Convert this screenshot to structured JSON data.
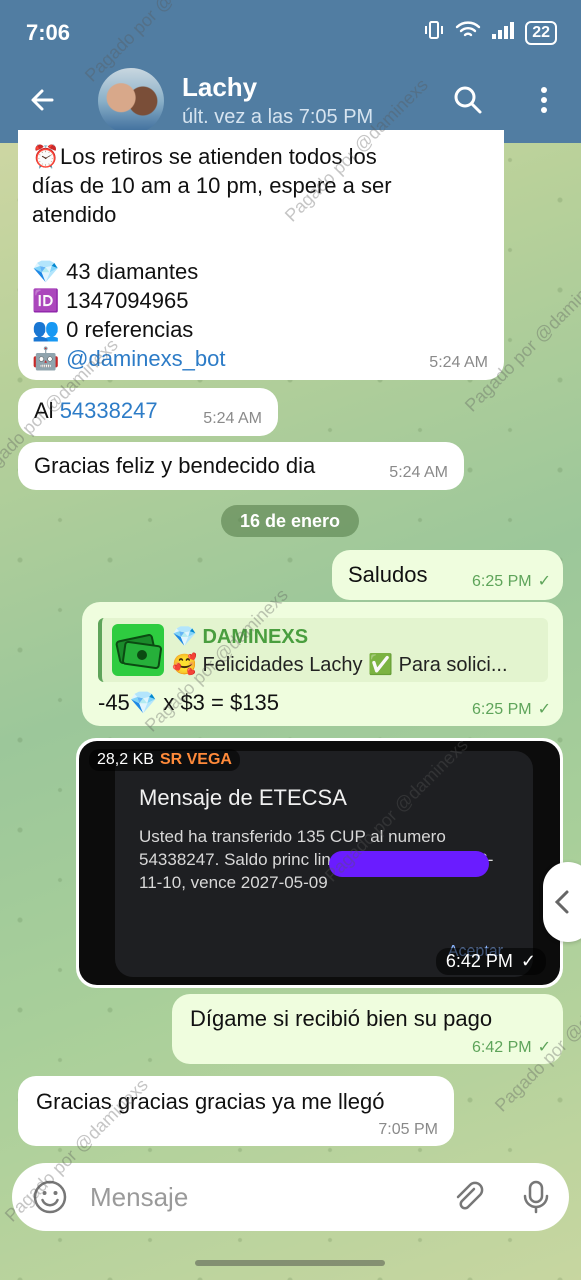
{
  "status_bar": {
    "time": "7:06",
    "battery": "22"
  },
  "header": {
    "contact_name": "Lachy",
    "last_seen": "últ. vez a las 7:05 PM"
  },
  "messages": {
    "bot": {
      "line1_icon": "alarm-clock-icon",
      "line1": "Los retiros se atienden todos los",
      "line2": "días de 10 am a 10 pm, espere a ser",
      "line3": "atendido",
      "diamonds": "43 diamantes",
      "id": "1347094965",
      "referrals": "0 referencias",
      "bot_handle": "@daminexs_bot",
      "time": "5:24 AM"
    },
    "al": {
      "prefix": "Al",
      "number": "54338247",
      "time": "5:24 AM"
    },
    "gracias1": {
      "text": "Gracias feliz y bendecido dia",
      "time": "5:24 AM"
    },
    "date_separator": "16 de enero",
    "saludos": {
      "text": "Saludos",
      "time": "6:25 PM"
    },
    "reply_msg": {
      "reply_title": "DAMINEXS",
      "reply_text": "Felicidades Lachy ✅ Para solici...",
      "text_left": "-45",
      "text_right": "x $3 = $135",
      "time": "6:25 PM"
    },
    "image_msg": {
      "size": "28,2 KB",
      "sender": "SR VEGA",
      "notif_title": "Mensaje de ETECSA",
      "notif_body": "Usted ha transferido 135 CUP al numero 54338247. Saldo princ linea activa hasta 2026-11-10, vence 2027-05-09",
      "accept": "Aceptar",
      "time": "6:42 PM"
    },
    "digame": {
      "text": "Dígame si recibió bien su pago",
      "time": "6:42 PM"
    },
    "gracias2": {
      "text": "Gracias gracias gracias ya me llegó",
      "time": "7:05 PM"
    }
  },
  "input": {
    "placeholder": "Mensaje"
  },
  "watermark": "Pagado por @daminexs",
  "colors": {
    "header": "#517da2",
    "outgoing_bubble": "#effdde",
    "check": "#5ea45a",
    "link": "#2d7cc7"
  }
}
